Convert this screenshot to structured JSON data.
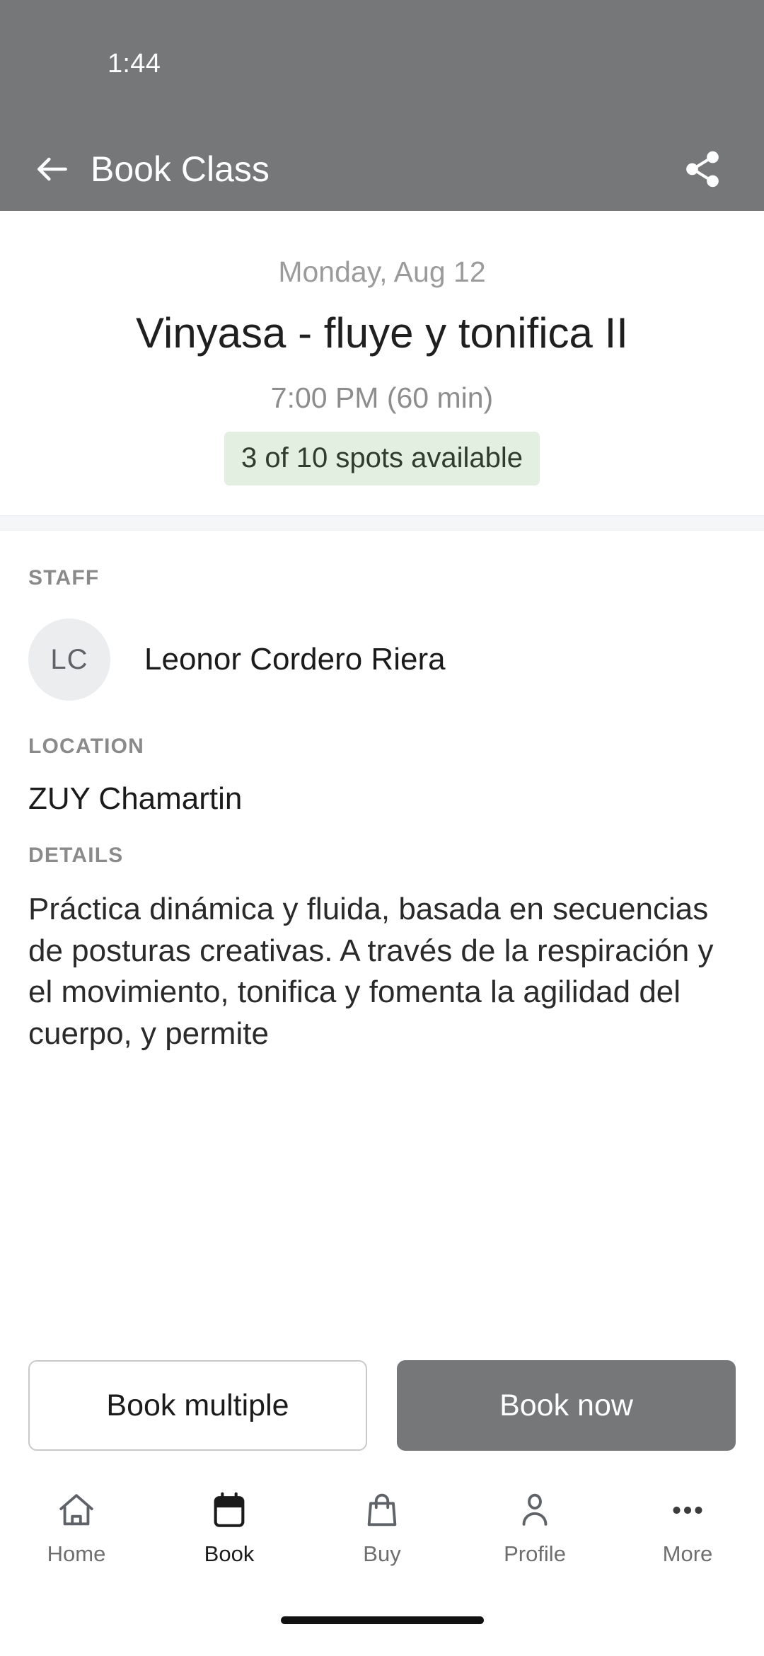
{
  "status_bar": {
    "time": "1:44"
  },
  "app_bar": {
    "title": "Book Class",
    "back_icon": "arrow-left-icon",
    "share_icon": "share-icon",
    "background_color": "#757779",
    "text_color": "#ffffff"
  },
  "class_header": {
    "date": "Monday, Aug 12",
    "title": "Vinyasa - fluye y tonifica II",
    "time": "7:00 PM (60 min)",
    "availability": "3 of 10 spots available",
    "availability_bg_color": "#e2efe1",
    "availability_text_color": "#2e3d2e"
  },
  "staff": {
    "label": "STAFF",
    "avatar_initials": "LC",
    "name": "Leonor Cordero Riera"
  },
  "location": {
    "label": "LOCATION",
    "value": "ZUY Chamartin"
  },
  "details": {
    "label": "DETAILS",
    "text": "Práctica dinámica y fluida, basada en secuencias de posturas creativas. A través de la respiración y el movimiento, tonifica y fomenta la agilidad del cuerpo, y permite"
  },
  "actions": {
    "book_multiple_label": "Book multiple",
    "book_now_label": "Book now",
    "book_now_bg_color": "#757779"
  },
  "bottom_nav": {
    "items": [
      {
        "label": "Home",
        "icon": "home-icon",
        "active": false
      },
      {
        "label": "Book",
        "icon": "calendar-icon",
        "active": true
      },
      {
        "label": "Buy",
        "icon": "bag-icon",
        "active": false
      },
      {
        "label": "Profile",
        "icon": "person-icon",
        "active": false
      },
      {
        "label": "More",
        "icon": "ellipsis-icon",
        "active": false
      }
    ]
  }
}
